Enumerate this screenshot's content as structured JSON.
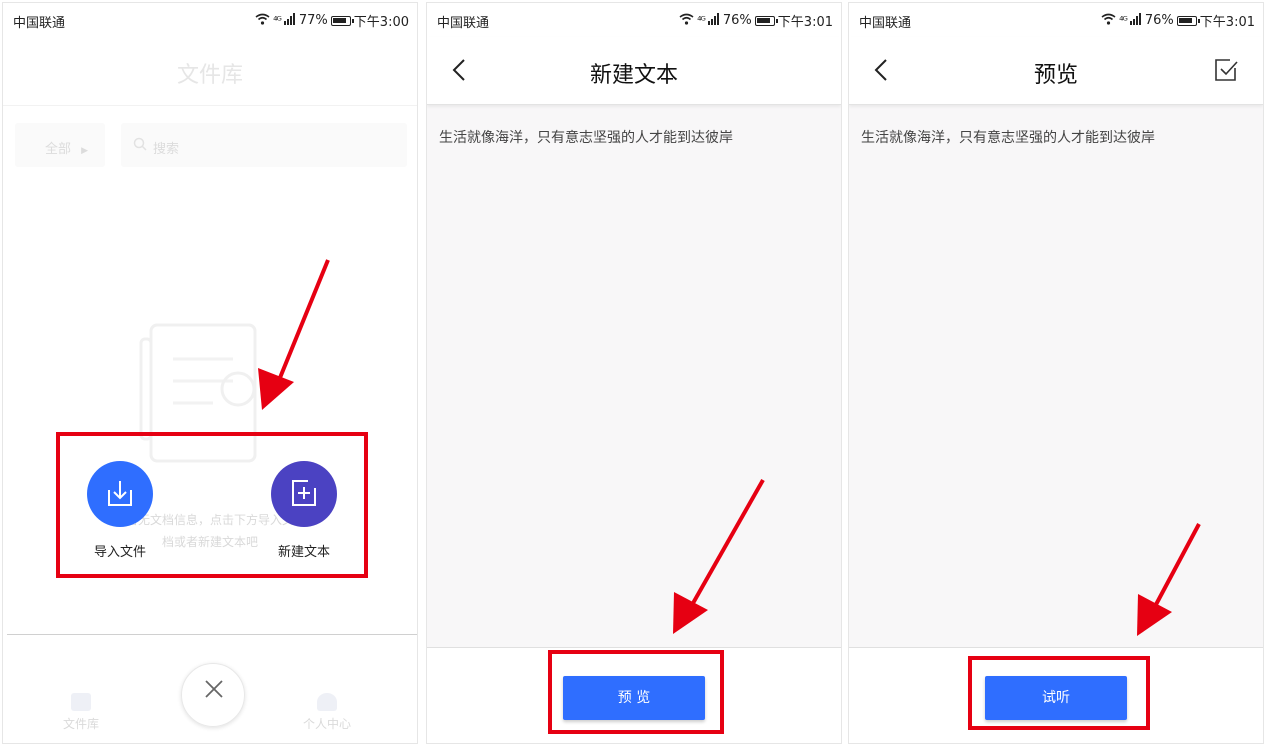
{
  "status_bars": [
    {
      "carrier": "中国联通",
      "network": "⁴ᴳ",
      "battery": "77%",
      "time": "下午3:00"
    },
    {
      "carrier": "中国联通",
      "network": "⁴ᴳ",
      "battery": "76%",
      "time": "下午3:01"
    },
    {
      "carrier": "中国联通",
      "network": "⁴ᴳ",
      "battery": "76%",
      "time": "下午3:01"
    }
  ],
  "library": {
    "title": "文件库",
    "filter_label": "全部",
    "search_placeholder": "搜索",
    "empty_line1": "暂无文档信息，点击下方导入文",
    "empty_line2": "档或者新建文本吧",
    "import_label": "导入文件",
    "new_text_label": "新建文本",
    "tab_library": "文件库",
    "tab_profile": "个人中心"
  },
  "new_text": {
    "title": "新建文本",
    "body_text": "生活就像海洋，只有意志坚强的人才能到达彼岸",
    "preview_button": "预 览"
  },
  "preview": {
    "title": "预览",
    "body_text": "生活就像海洋，只有意志坚强的人才能到达彼岸",
    "listen_button": "试听"
  },
  "colors": {
    "primary_blue": "#2f6eff",
    "import_fab": "#2f6eff",
    "new_text_fab": "#4b42c2",
    "annotation_red": "#e60012"
  }
}
